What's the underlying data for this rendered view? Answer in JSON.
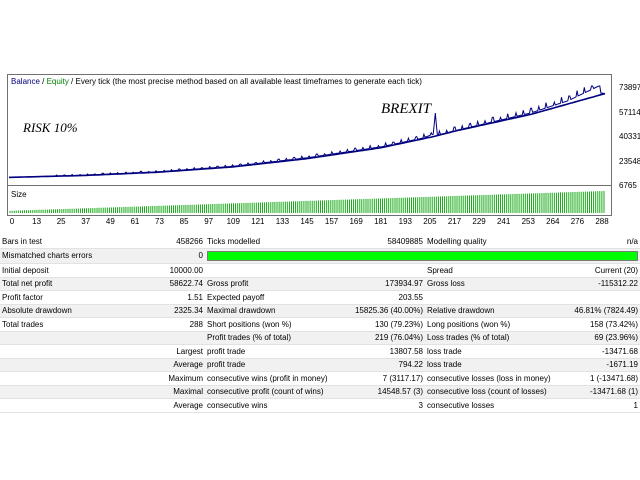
{
  "chart": {
    "legend": {
      "balance": "Balance",
      "sep": " / ",
      "equity": "Equity",
      "mode": " / Every tick (the most precise method based on all available least timeframes to generate each tick)"
    },
    "annotations": {
      "risk": "RISK 10%",
      "brexit": "BREXIT"
    },
    "size_label": "Size",
    "y_ticks": [
      "73897",
      "57114",
      "40331",
      "23548",
      "6765"
    ],
    "x_ticks": [
      "0",
      "13",
      "25",
      "37",
      "49",
      "61",
      "73",
      "85",
      "97",
      "109",
      "121",
      "133",
      "145",
      "157",
      "169",
      "181",
      "193",
      "205",
      "217",
      "229",
      "241",
      "253",
      "264",
      "276",
      "288"
    ],
    "colors": {
      "balance": "#00007f",
      "equity": "#008000",
      "size_bars": "#00a000",
      "quality_bar": "#00ff00"
    }
  },
  "chart_data": {
    "type": "line",
    "x_range": [
      0,
      288
    ],
    "y_range": [
      6765,
      73897
    ],
    "series": [
      {
        "name": "Balance",
        "x": [
          0,
          36,
          72,
          108,
          144,
          180,
          205,
          216,
          252,
          288
        ],
        "y": [
          10000,
          11300,
          13600,
          17300,
          23100,
          30800,
          38500,
          42500,
          54000,
          68600
        ]
      },
      {
        "name": "Equity",
        "x": [
          0,
          36,
          72,
          108,
          144,
          180,
          200,
          205,
          206,
          207,
          216,
          252,
          270,
          285,
          286,
          288
        ],
        "y": [
          10000,
          11500,
          13900,
          17700,
          23700,
          31400,
          37500,
          40200,
          55000,
          39500,
          42800,
          55000,
          63500,
          73897,
          69000,
          68600
        ]
      }
    ],
    "size_bars": {
      "count": 288,
      "relative_height_start": 0.1,
      "relative_height_end": 1.0
    }
  },
  "stats": {
    "r1": {
      "a": "Bars in test",
      "b": "458266",
      "c": "Ticks modelled",
      "d": "58409885",
      "e": "Modelling quality",
      "f": "n/a"
    },
    "r2": {
      "a": "Mismatched charts errors",
      "b": "0"
    },
    "r3": {
      "a": "Initial deposit",
      "b": "10000.00",
      "e": "Spread",
      "f": "Current (20)"
    },
    "r4": {
      "a": "Total net profit",
      "b": "58622.74",
      "c": "Gross profit",
      "d": "173934.97",
      "e": "Gross loss",
      "f": "-115312.22"
    },
    "r5": {
      "a": "Profit factor",
      "b": "1.51",
      "c": "Expected payoff",
      "d": "203.55"
    },
    "r6": {
      "a": "Absolute drawdown",
      "b": "2325.34",
      "c": "Maximal drawdown",
      "d": "15825.36 (40.00%)",
      "e": "Relative drawdown",
      "f": "46.81% (7824.49)"
    },
    "r7": {
      "a": "Total trades",
      "b": "288",
      "c": "Short positions (won %)",
      "d": "130 (79.23%)",
      "e": "Long positions (won %)",
      "f": "158 (73.42%)"
    },
    "r8": {
      "c": "Profit trades (% of total)",
      "d": "219 (76.04%)",
      "e": "Loss trades (% of total)",
      "f": "69 (23.96%)"
    },
    "r9": {
      "b": "Largest",
      "c": "profit trade",
      "d": "13807.58",
      "e": "loss trade",
      "f": "-13471.68"
    },
    "r10": {
      "b": "Average",
      "c": "profit trade",
      "d": "794.22",
      "e": "loss trade",
      "f": "-1671.19"
    },
    "r11": {
      "b": "Maximum",
      "c": "consecutive wins (profit in money)",
      "d": "7 (3117.17)",
      "e": "consecutive losses (loss in money)",
      "f": "1 (-13471.68)"
    },
    "r12": {
      "b": "Maximal",
      "c": "consecutive profit (count of wins)",
      "d": "14548.57 (3)",
      "e": "consecutive loss (count of losses)",
      "f": "-13471.68 (1)"
    },
    "r13": {
      "b": "Average",
      "c": "consecutive wins",
      "d": "3",
      "e": "consecutive losses",
      "f": "1"
    }
  }
}
